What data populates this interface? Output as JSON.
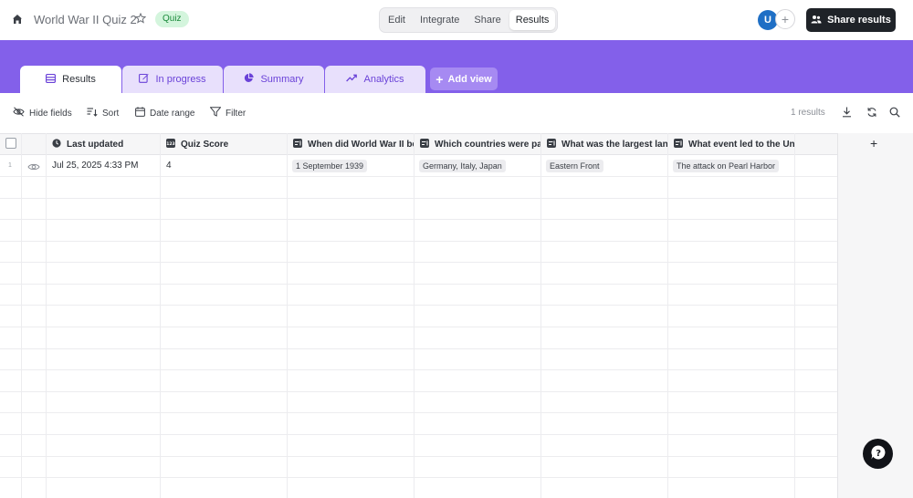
{
  "header": {
    "title": "World War II Quiz 2",
    "badge": "Quiz",
    "modes": [
      "Edit",
      "Integrate",
      "Share",
      "Results"
    ],
    "active_mode": "Results",
    "avatar_initial": "U",
    "share_label": "Share results",
    "icons": {
      "home": "home-icon",
      "star": "star-icon",
      "add_collaborator": "plus-icon",
      "share": "users-icon"
    }
  },
  "tabs": [
    {
      "label": "Results",
      "icon": "table-icon",
      "active": true
    },
    {
      "label": "In progress",
      "icon": "edit-icon",
      "active": false
    },
    {
      "label": "Summary",
      "icon": "pie-chart-icon",
      "active": false
    },
    {
      "label": "Analytics",
      "icon": "trend-icon",
      "active": false
    }
  ],
  "add_view_label": "Add view",
  "toolbar": {
    "hide_fields": "Hide fields",
    "sort": "Sort",
    "date_range": "Date range",
    "filter": "Filter",
    "results_count": "1 results",
    "icons": [
      "download-icon",
      "refresh-icon",
      "search-icon"
    ]
  },
  "table": {
    "columns": [
      {
        "label": "Last updated",
        "icon": "clock-icon"
      },
      {
        "label": "Quiz Score",
        "icon": "number-icon"
      },
      {
        "label": "When did World War II beg",
        "icon": "text-field-icon"
      },
      {
        "label": "Which countries were part",
        "icon": "text-field-icon"
      },
      {
        "label": "What was the largest land",
        "icon": "text-field-icon"
      },
      {
        "label": "What event led to the Unite",
        "icon": "text-field-icon"
      }
    ],
    "rows": [
      {
        "number": "1",
        "last_updated": "Jul 25, 2025 4:33 PM",
        "score": "4",
        "answers": [
          "1 September 1939",
          "Germany, Italy, Japan",
          "Eastern Front",
          "The attack on Pearl Harbor"
        ]
      }
    ],
    "add_column_label": "+"
  },
  "colors": {
    "accent": "#8360ea",
    "tab_bg": "#e8e0fc",
    "badge_bg": "#d4f5dd",
    "badge_text": "#1a8a3a",
    "dark_button": "#1f2328"
  }
}
